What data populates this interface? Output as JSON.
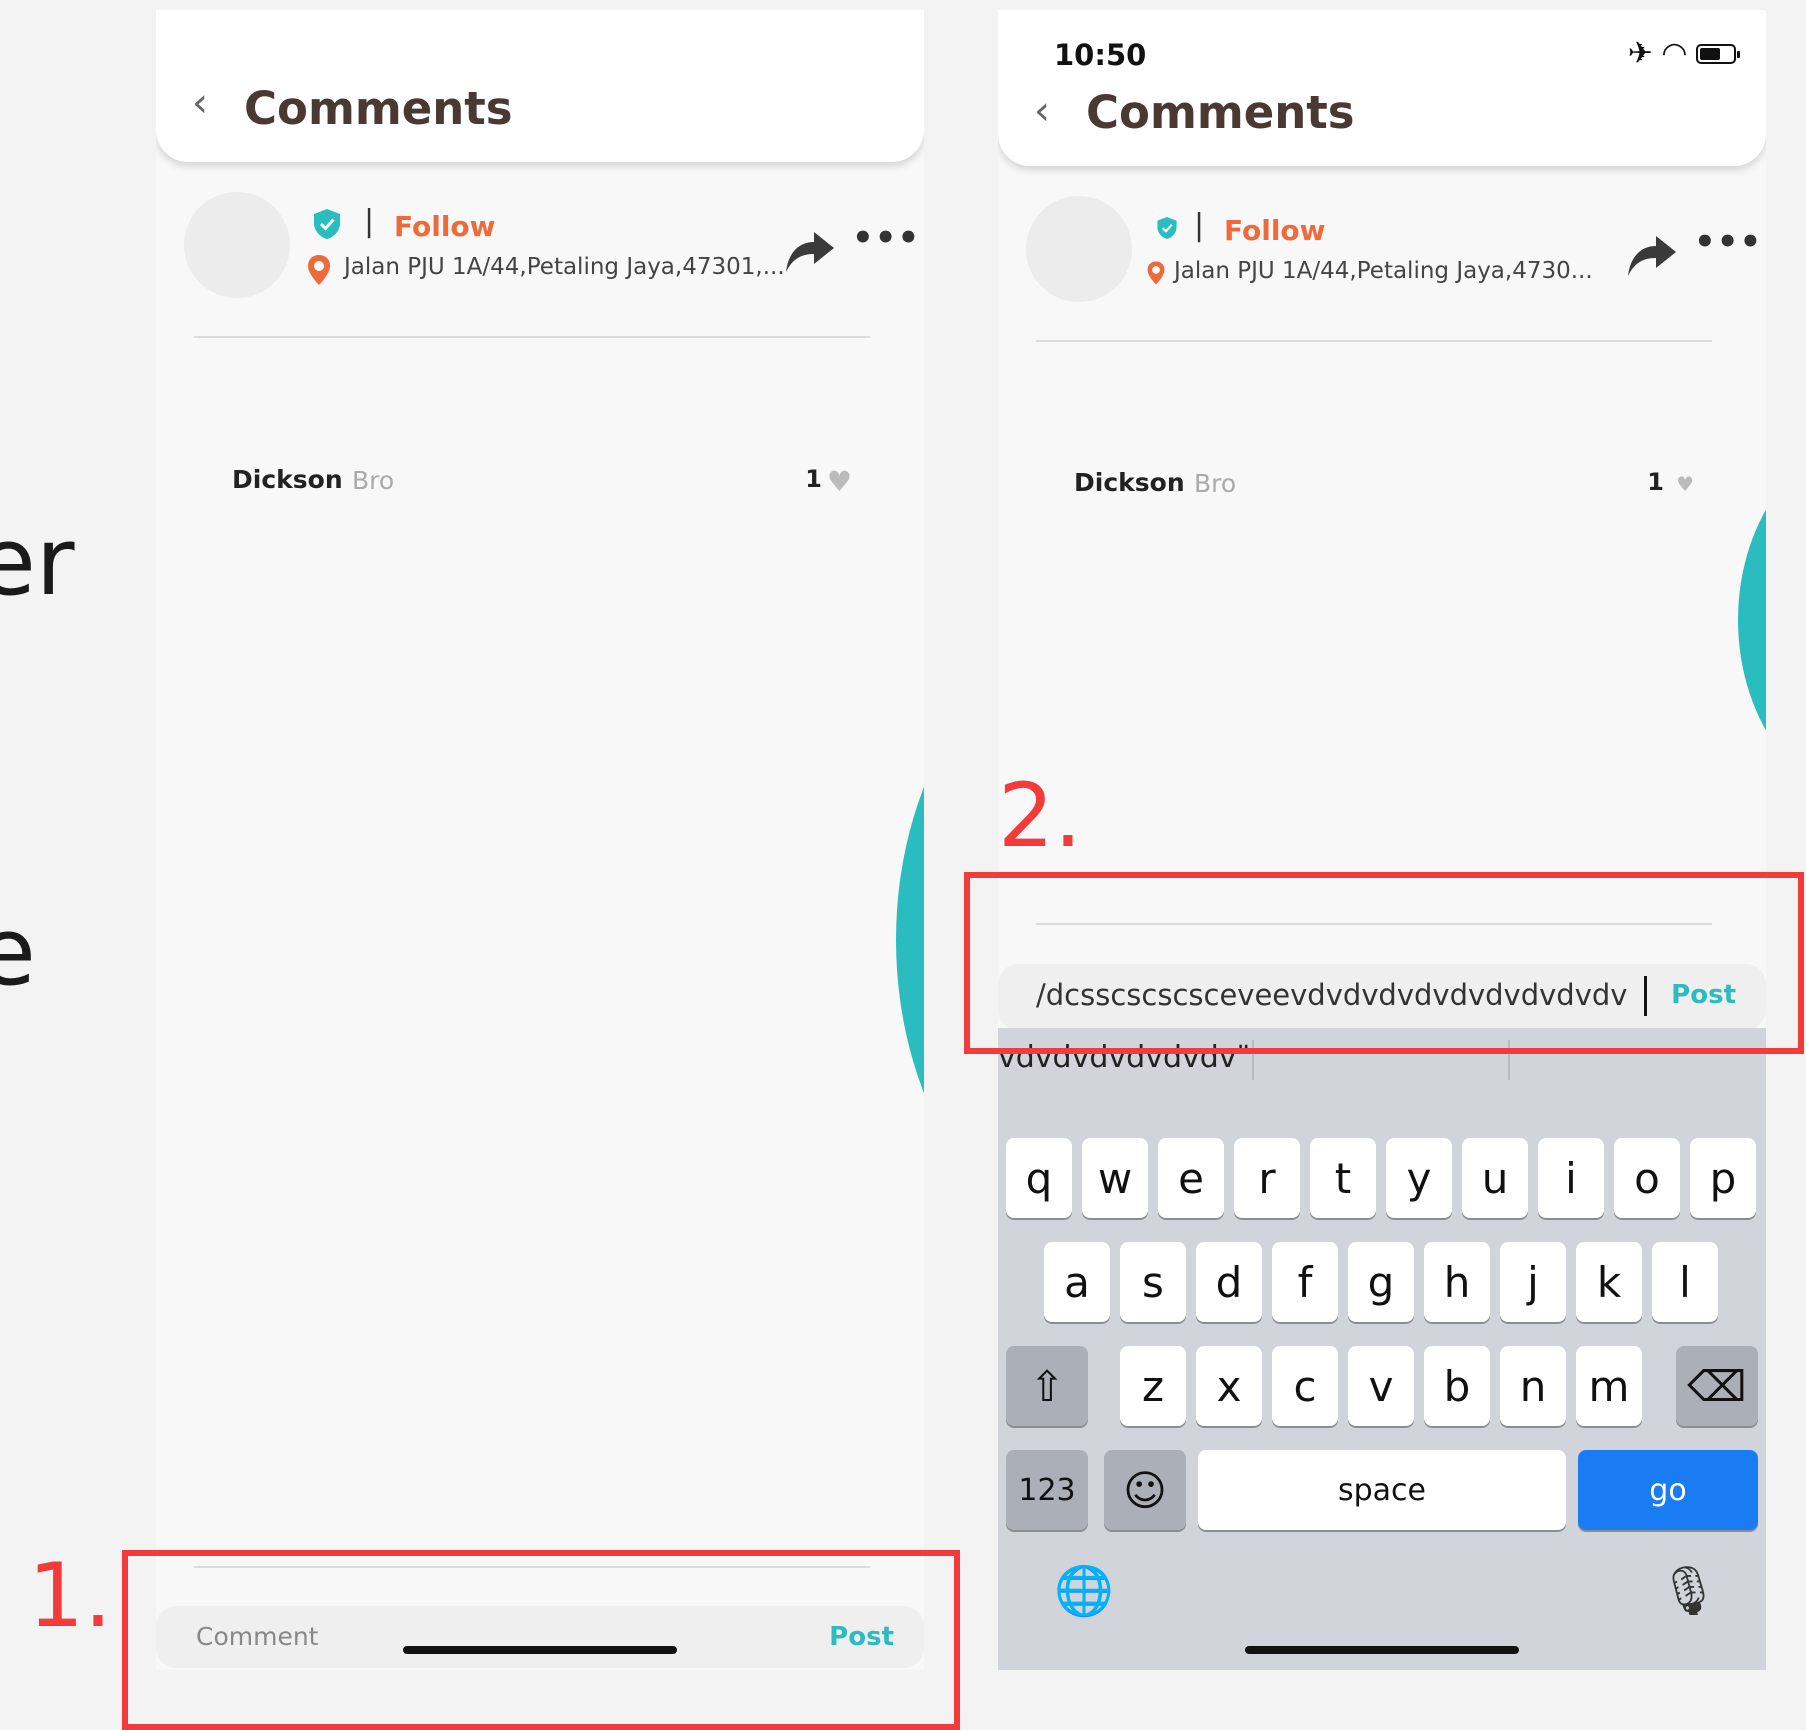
{
  "edge_text": {
    "line1": "er",
    "line2": "e"
  },
  "screen1": {
    "header": {
      "back_icon": "‹",
      "title": "Comments"
    },
    "post": {
      "separator": "|",
      "follow": "Follow",
      "location": "Jalan PJU 1A/44,Petaling Jaya,47301,...",
      "more": "•••"
    },
    "comment": {
      "user": "Dickson",
      "text": "Bro",
      "likes": "1",
      "heart": "♥"
    },
    "input": {
      "placeholder": "Comment",
      "post": "Post"
    }
  },
  "screen2": {
    "status": {
      "time": "10:50",
      "airplane": "✈",
      "wifi": "◠"
    },
    "header": {
      "back_icon": "‹",
      "title": "Comments"
    },
    "post": {
      "separator": "|",
      "follow": "Follow",
      "location": "Jalan PJU 1A/44,Petaling Jaya,4730...",
      "more": "•••"
    },
    "comment": {
      "user": "Dickson",
      "text": "Bro",
      "likes": "1",
      "heart": "♥"
    },
    "input": {
      "value": "/dcsscscscsceveevdvdvdvdvdvdvdvdvdv",
      "post": "Post"
    },
    "keyboard": {
      "suggestion": "vdvdvdvdvdvdv\"",
      "row1": [
        "q",
        "w",
        "e",
        "r",
        "t",
        "y",
        "u",
        "i",
        "o",
        "p"
      ],
      "row2": [
        "a",
        "s",
        "d",
        "f",
        "g",
        "h",
        "j",
        "k",
        "l"
      ],
      "row3": [
        "z",
        "x",
        "c",
        "v",
        "b",
        "n",
        "m"
      ],
      "shift": "⇧",
      "delete": "⌫",
      "numbers": "123",
      "emoji": "☺",
      "space": "space",
      "go": "go",
      "globe": "🌐",
      "mic": "🎙"
    }
  },
  "annotations": {
    "label1": "1.",
    "label2": "2."
  },
  "colors": {
    "accent_teal": "#2bbcc0",
    "follow_orange": "#ef6a3a",
    "highlight_red": "#f23b3b",
    "go_blue": "#1a7cf2"
  }
}
